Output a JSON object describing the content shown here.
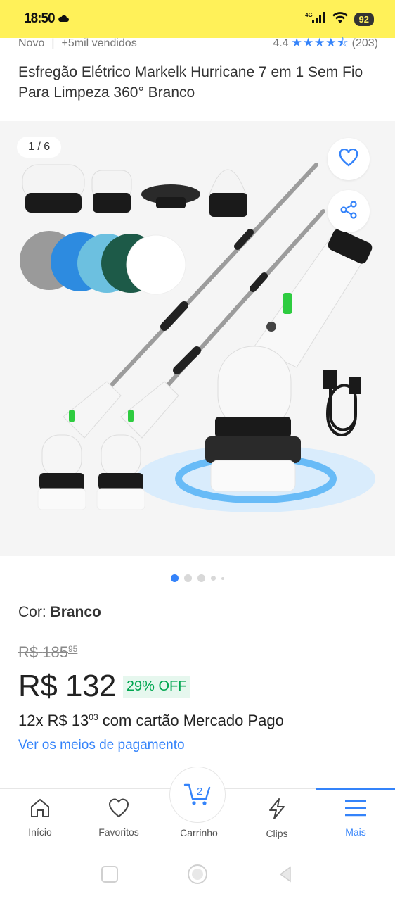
{
  "statusbar": {
    "time": "18:50",
    "network": "4G",
    "battery": "92"
  },
  "product": {
    "condition": "Novo",
    "sold": "+5mil vendidos",
    "rating": "4.4",
    "reviews": "(203)",
    "title": "Esfregão Elétrico Markelk Hurricane 7 em 1 Sem Fio Para Limpeza 360° Branco"
  },
  "gallery": {
    "counter": "1 / 6",
    "favorite_icon": "heart-icon",
    "share_icon": "share-icon"
  },
  "color": {
    "label": "Cor:",
    "value": "Branco"
  },
  "pricing": {
    "old_currency": "R$",
    "old_price": "185",
    "old_cents": "95",
    "price": "R$ 132",
    "discount": "29% OFF",
    "installment_prefix": "12x R$ 13",
    "installment_cents": "03",
    "installment_suffix": "com cartão Mercado Pago",
    "payment_link": "Ver os meios de pagamento"
  },
  "nav": {
    "home": "Início",
    "favorites": "Favoritos",
    "cart": "Carrinho",
    "cart_count": "2",
    "clips": "Clips",
    "more": "Mais"
  },
  "colors": {
    "brand_yellow": "#fff159",
    "accent_blue": "#3483fa",
    "discount_green": "#00a650"
  }
}
